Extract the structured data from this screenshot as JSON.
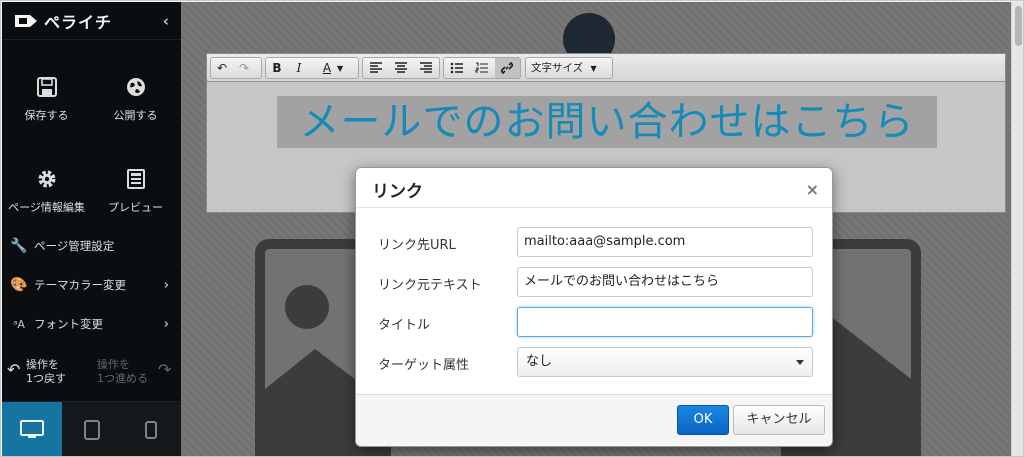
{
  "app": {
    "title": "ペライチ",
    "colors": {
      "sidebar_bg": "#0c0f12",
      "accent": "#167aa8",
      "ok_button": "#0a64c4",
      "headline_text": "#1790c0"
    }
  },
  "sidebar": {
    "collapse_icon": "chevron-left-icon",
    "save_label": "保存する",
    "publish_label": "公開する",
    "page_info_label": "ページ情報編集",
    "preview_label": "プレビュー",
    "menu": [
      {
        "label": "ページ管理設定",
        "icon": "wrench-icon"
      },
      {
        "label": "テーマカラー変更",
        "icon": "palette-icon"
      },
      {
        "label": "フォント変更",
        "icon": "font-icon"
      }
    ],
    "undo_line1": "操作を",
    "undo_line2": "1つ戻す",
    "redo_line1": "操作を",
    "redo_line2": "1つ進める",
    "devices": [
      "desktop-icon",
      "tablet-icon",
      "mobile-icon"
    ]
  },
  "toolbar": {
    "font_size_label": "文字サイズ"
  },
  "editor": {
    "headline": "メールでのお問い合わせはこちら"
  },
  "dialog": {
    "title": "リンク",
    "close": "×",
    "url_label": "リンク先URL",
    "url_value": "mailto:aaa@sample.com",
    "text_label": "リンク元テキスト",
    "text_value": "メールでのお問い合わせはこちら",
    "title_label": "タイトル",
    "title_value": "",
    "target_label": "ターゲット属性",
    "target_value": "なし",
    "ok_label": "OK",
    "cancel_label": "キャンセル"
  }
}
